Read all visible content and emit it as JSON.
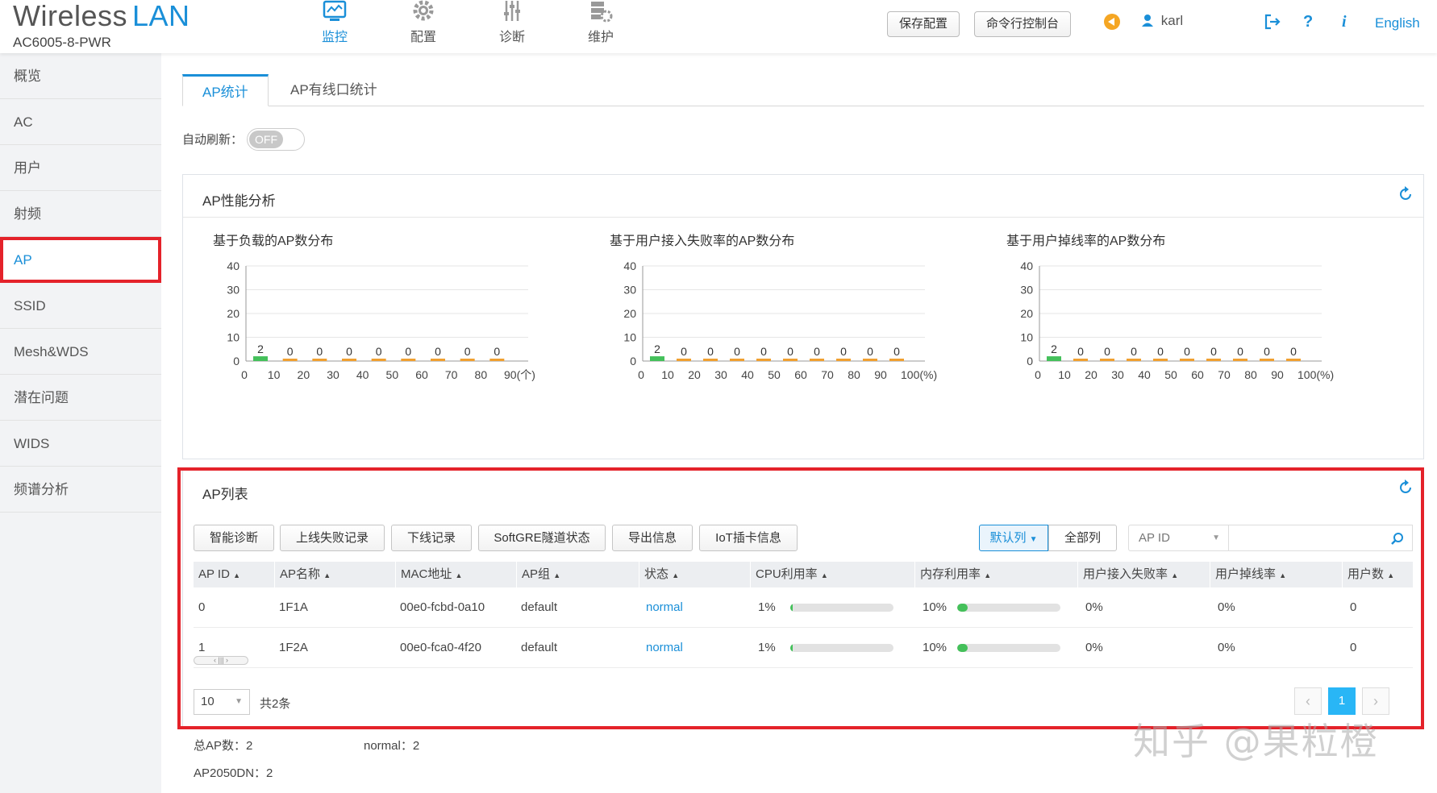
{
  "brand": {
    "title_a": "Wireless",
    "title_b": "LAN",
    "model": "AC6005-8-PWR"
  },
  "nav": [
    {
      "label": "监控",
      "icon": "monitor-icon",
      "active": true
    },
    {
      "label": "配置",
      "icon": "gear-icon"
    },
    {
      "label": "诊断",
      "icon": "sliders-icon"
    },
    {
      "label": "维护",
      "icon": "maintenance-icon"
    }
  ],
  "header": {
    "save_config": "保存配置",
    "cli_console": "命令行控制台",
    "user": "karl",
    "language": "English",
    "help": "?",
    "info": "i"
  },
  "sidebar": {
    "items": [
      {
        "label": "概览"
      },
      {
        "label": "AC"
      },
      {
        "label": "用户"
      },
      {
        "label": "射频"
      },
      {
        "label": "AP",
        "active": true
      },
      {
        "label": "SSID"
      },
      {
        "label": "Mesh&WDS"
      },
      {
        "label": "潜在问题"
      },
      {
        "label": "WIDS"
      },
      {
        "label": "频谱分析"
      }
    ]
  },
  "tabs": [
    {
      "label": "AP统计",
      "active": true
    },
    {
      "label": "AP有线口统计"
    }
  ],
  "auto_refresh": {
    "label": "自动刷新：",
    "state": "OFF"
  },
  "perf_panel": {
    "title": "AP性能分析"
  },
  "chart_data": [
    {
      "type": "bar",
      "title": "基于负载的AP数分布",
      "x_ticks": [
        "0",
        "10",
        "20",
        "30",
        "40",
        "50",
        "60",
        "70",
        "80",
        "90(个)"
      ],
      "values": [
        2,
        0,
        0,
        0,
        0,
        0,
        0,
        0,
        0
      ],
      "ylim": [
        0,
        40
      ],
      "y_ticks": [
        0,
        10,
        20,
        30,
        40
      ],
      "grid": true
    },
    {
      "type": "bar",
      "title": "基于用户接入失败率的AP数分布",
      "x_ticks": [
        "0",
        "10",
        "20",
        "30",
        "40",
        "50",
        "60",
        "70",
        "80",
        "90",
        "100(%)"
      ],
      "values": [
        2,
        0,
        0,
        0,
        0,
        0,
        0,
        0,
        0,
        0
      ],
      "ylim": [
        0,
        40
      ],
      "y_ticks": [
        0,
        10,
        20,
        30,
        40
      ],
      "grid": true
    },
    {
      "type": "bar",
      "title": "基于用户掉线率的AP数分布",
      "x_ticks": [
        "0",
        "10",
        "20",
        "30",
        "40",
        "50",
        "60",
        "70",
        "80",
        "90",
        "100(%)"
      ],
      "values": [
        2,
        0,
        0,
        0,
        0,
        0,
        0,
        0,
        0,
        0
      ],
      "ylim": [
        0,
        40
      ],
      "y_ticks": [
        0,
        10,
        20,
        30,
        40
      ],
      "grid": true
    }
  ],
  "ap_list": {
    "title": "AP列表",
    "toolbar": [
      "智能诊断",
      "上线失败记录",
      "下线记录",
      "SoftGRE隧道状态",
      "导出信息",
      "IoT插卡信息"
    ],
    "col_default": "默认列",
    "col_all": "全部列",
    "search_field": "AP ID",
    "columns": [
      "AP ID",
      "AP名称",
      "MAC地址",
      "AP组",
      "状态",
      "CPU利用率",
      "内存利用率",
      "用户接入失败率",
      "用户掉线率",
      "用户数"
    ],
    "rows": [
      {
        "id": "0",
        "name": "1F1A",
        "mac": "00e0-fcbd-0a10",
        "group": "default",
        "status": "normal",
        "cpu": "1%",
        "cpu_frac": 0.01,
        "mem": "10%",
        "mem_frac": 0.1,
        "fail": "0%",
        "drop": "0%",
        "users": "0"
      },
      {
        "id": "1",
        "name": "1F2A",
        "mac": "00e0-fca0-4f20",
        "group": "default",
        "status": "normal",
        "cpu": "1%",
        "cpu_frac": 0.01,
        "mem": "10%",
        "mem_frac": 0.1,
        "fail": "0%",
        "drop": "0%",
        "users": "0"
      }
    ],
    "page_size": "10",
    "total": "共2条",
    "current_page": "1"
  },
  "summary": {
    "total_ap": "总AP数：2",
    "normal": "normal：2",
    "model": "AP2050DN：2"
  },
  "watermark": "知乎 @果粒橙",
  "colors": {
    "accent": "#1a8fd8",
    "highlight": "#e4222a",
    "bar_green": "#44c05a",
    "bar_orange": "#f0a030"
  }
}
